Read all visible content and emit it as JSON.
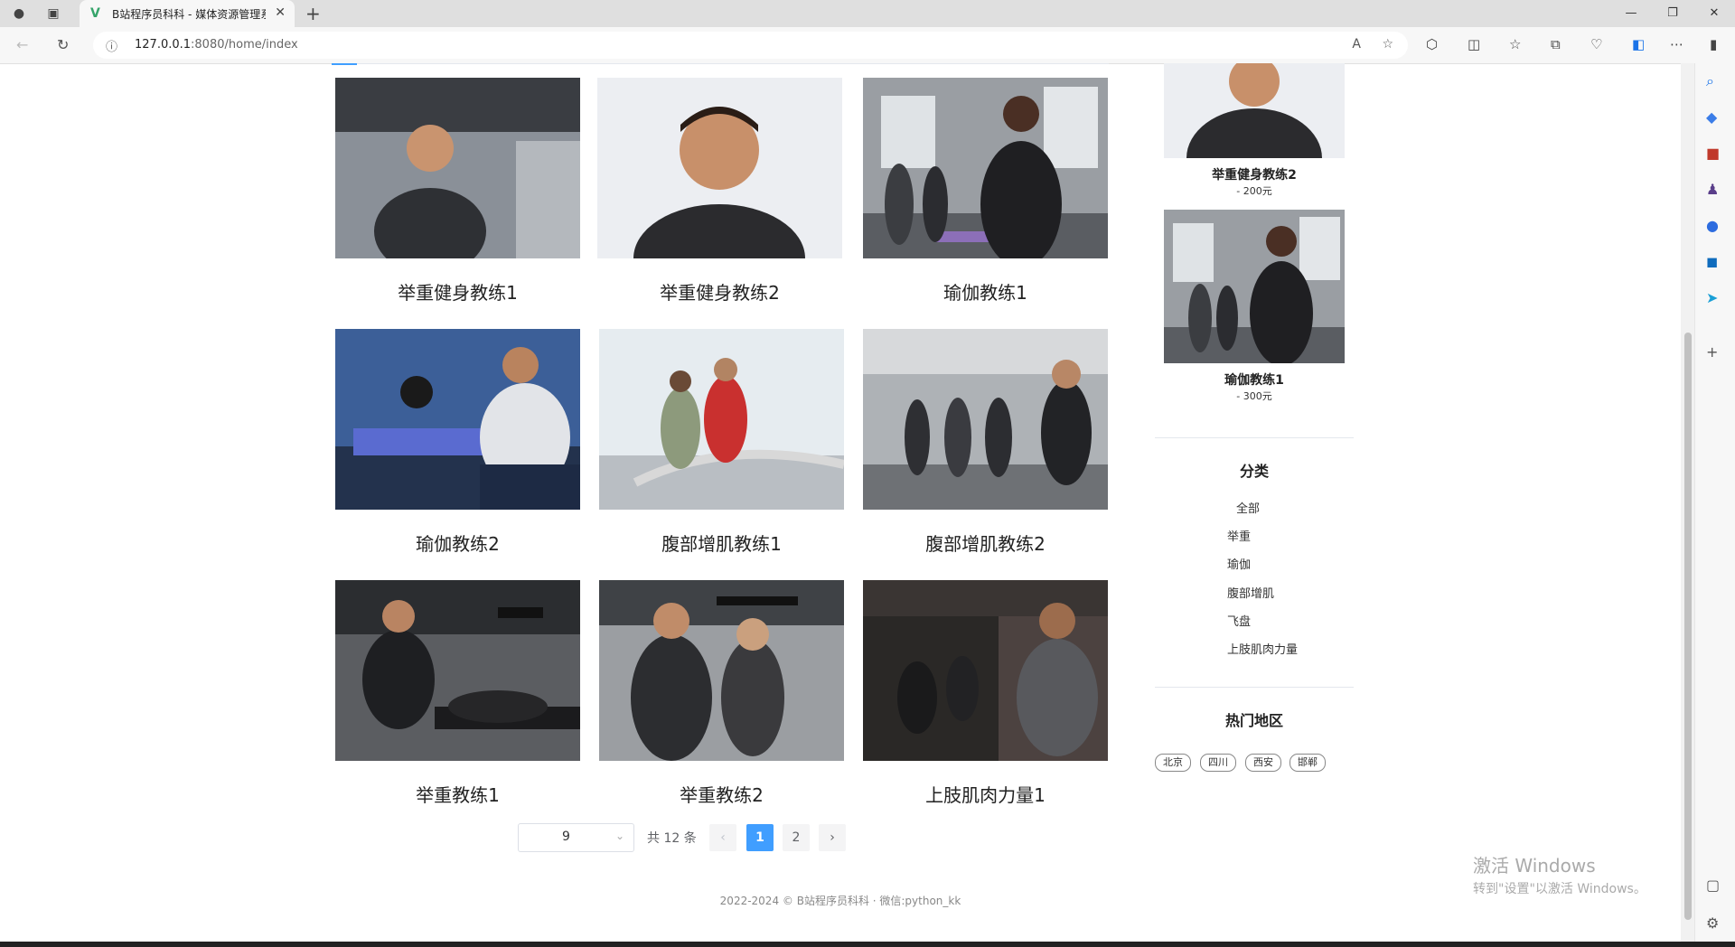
{
  "browser": {
    "tab_title": "B站程序员科科 - 媒体资源管理系",
    "favicon": "V",
    "url_host": "127.0.0.1",
    "url_rest": ":8080/home/index"
  },
  "cards": [
    {
      "name": "举重健身教练1"
    },
    {
      "name": "举重健身教练2"
    },
    {
      "name": "瑜伽教练1"
    },
    {
      "name": "瑜伽教练2"
    },
    {
      "name": "腹部增肌教练1"
    },
    {
      "name": "腹部增肌教练2"
    },
    {
      "name": "举重教练1"
    },
    {
      "name": "举重教练2"
    },
    {
      "name": "上肢肌肉力量1"
    }
  ],
  "hot": [
    {
      "title": "举重健身教练2",
      "price": "- 200元"
    },
    {
      "title": "瑜伽教练1",
      "price": "- 300元"
    }
  ],
  "categories": {
    "title": "分类",
    "items": [
      "全部",
      "举重",
      "瑜伽",
      "腹部增肌",
      "飞盘",
      "上肢肌肉力量"
    ]
  },
  "regions": {
    "title": "热门地区",
    "tags": [
      "北京",
      "四川",
      "西安",
      "邯郸"
    ]
  },
  "pagination": {
    "page_size": "9",
    "total": "共 12 条",
    "prev": "‹",
    "next": "›",
    "pages": [
      "1",
      "2"
    ],
    "current": "1"
  },
  "footer": "2022-2024 © B站程序员科科 · 微信:python_kk",
  "watermark": {
    "line1": "激活 Windows",
    "line2": "转到\"设置\"以激活 Windows。"
  },
  "colors": {
    "accent": "#409eff"
  }
}
